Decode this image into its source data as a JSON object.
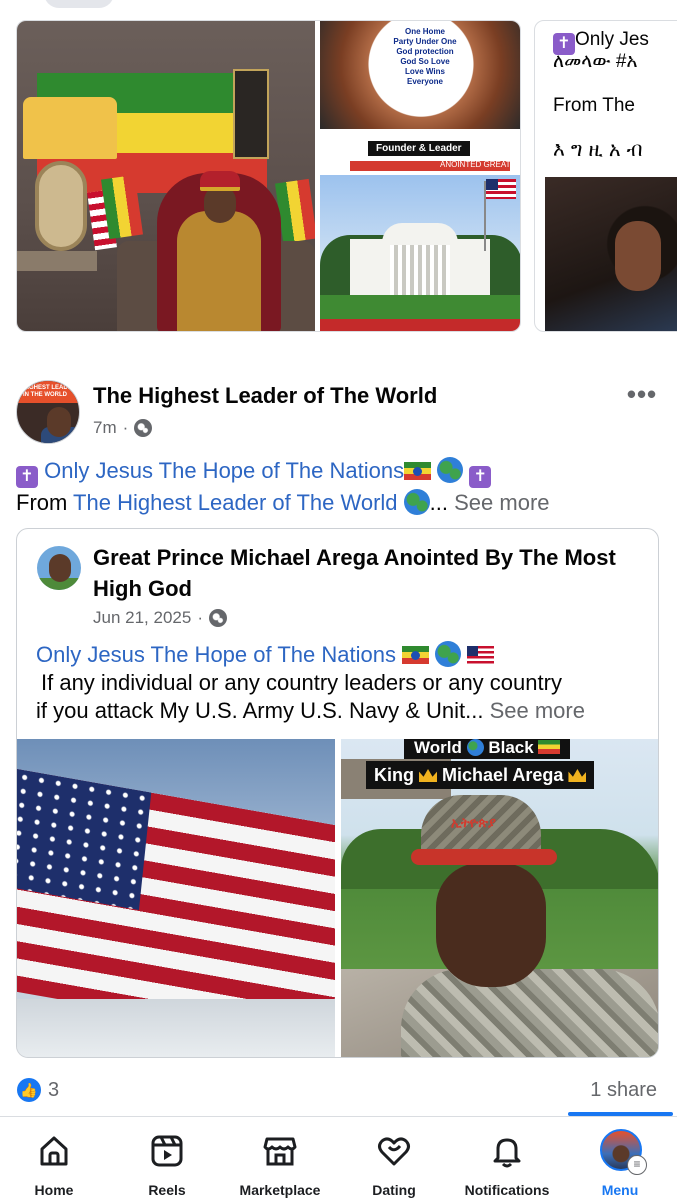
{
  "carousel": {
    "card1": {
      "poster_lines": [
        "One",
        "Home",
        "Party",
        "Under One",
        "God protection",
        "God So",
        "Love",
        "Love",
        "Wins",
        "Everyone"
      ],
      "poster_founder": "Founder & Leader",
      "poster_anointed": "ANOINTED GREAT"
    },
    "card2": {
      "line1": "Only Jes",
      "line2": "ለመላው #አ",
      "line3": "From The",
      "line4": "እግዚአብ"
    }
  },
  "post": {
    "author": "The Highest Leader of The World",
    "time": "7m",
    "avatar_text": "HIGHEST LEADER IN THE WORLD",
    "text_line1_link": "Only Jesus The Hope of The Nations",
    "text_line2_prefix": "From ",
    "text_line2_link": "The Highest Leader of The World",
    "text_ellipsis": "...",
    "see_more": "See more"
  },
  "shared_post": {
    "author": "Great Prince Michael Arega Anointed By The Most High God",
    "date": "Jun 21, 2025",
    "text_link": "Only Jesus The Hope of The Nations",
    "text_line2": "If any individual or any country leaders or any country",
    "text_line3": "if you attack My U.S. Army U.S. Navy & Unit...",
    "see_more": "See more",
    "photo2_caption_line1_a": "World",
    "photo2_caption_line1_b": "Black",
    "photo2_caption_line2_a": "King",
    "photo2_caption_line2_b": "Michael Arega",
    "cap_text": "ኢትዮጵያ"
  },
  "reactions": {
    "like_count": "3",
    "share_text": "1 share"
  },
  "nav": {
    "tabs": [
      {
        "label": "Home",
        "icon": "home-icon"
      },
      {
        "label": "Reels",
        "icon": "reels-icon"
      },
      {
        "label": "Marketplace",
        "icon": "marketplace-icon"
      },
      {
        "label": "Dating",
        "icon": "dating-icon"
      },
      {
        "label": "Notifications",
        "icon": "bell-icon"
      },
      {
        "label": "Menu",
        "icon": "profile-avatar"
      }
    ],
    "active_tab": "Menu"
  },
  "colors": {
    "link": "#2d66c3",
    "accent": "#1877f2",
    "secondary_text": "#65676b"
  }
}
